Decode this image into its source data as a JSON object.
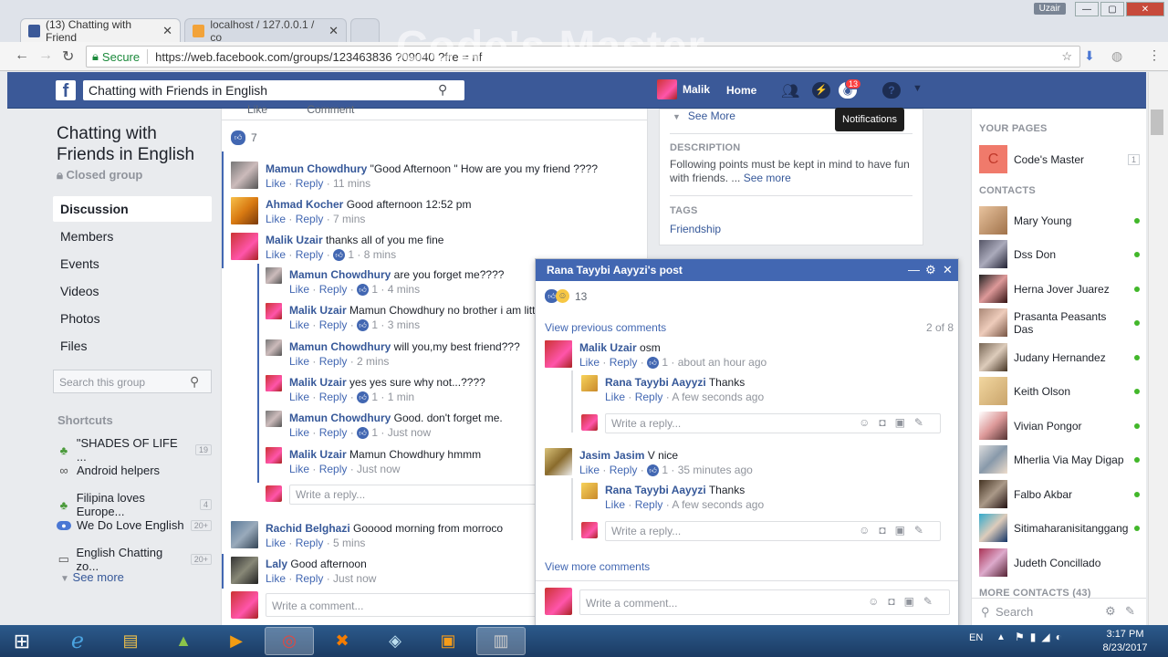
{
  "browser": {
    "tabs": [
      {
        "title": "(13) Chatting with Friend"
      },
      {
        "title": "localhost / 127.0.0.1 / co"
      }
    ],
    "user_badge": "Uzair",
    "secure_label": "Secure",
    "url": "https://web.facebook.com/groups/123463836 ?09040 ?fre = nf",
    "watermark": "Code's Master"
  },
  "fb_header": {
    "search_value": "Chatting with Friends in English",
    "user_name": "Malik",
    "home_label": "Home",
    "notif_count": "13",
    "tooltip": "Notifications"
  },
  "left": {
    "group_name": "Chatting with Friends in English",
    "group_type": "Closed group",
    "nav": [
      {
        "label": "Discussion"
      },
      {
        "label": "Members"
      },
      {
        "label": "Events"
      },
      {
        "label": "Videos"
      },
      {
        "label": "Photos"
      },
      {
        "label": "Files"
      }
    ],
    "search_placeholder": "Search this group",
    "shortcuts_heading": "Shortcuts",
    "shortcuts": [
      {
        "label": "\"SHADES OF LIFE ...",
        "count": "19"
      },
      {
        "label": "Android helpers",
        "count": ""
      },
      {
        "label": "Filipina loves Europe...",
        "count": "4"
      },
      {
        "label": "We Do Love English",
        "count": "20+"
      },
      {
        "label": "English Chatting zo...",
        "count": "20+"
      }
    ],
    "see_more": "See more"
  },
  "feed": {
    "like_label": "Like",
    "comment_label": "Comment",
    "reactions": "7",
    "comments": [
      {
        "name": "Mamun Chowdhury",
        "text": "\"Good Afternoon \" How are you my friend ????",
        "likes": "",
        "time": "11 mins"
      },
      {
        "name": "Ahmad Kocher",
        "text": "Good afternoon 12:52 pm",
        "likes": "",
        "time": "7 mins"
      },
      {
        "name": "Malik Uzair",
        "text": "thanks all of you me fine",
        "likes": "1",
        "time": "8 mins"
      }
    ],
    "replies": [
      {
        "name": "Mamun Chowdhury",
        "text": "are you forget me????",
        "likes": "1",
        "time": "4 mins"
      },
      {
        "name": "Malik Uzair",
        "text": "Mamun Chowdhury no brother i am little b",
        "likes": "1",
        "time": "3 mins"
      },
      {
        "name": "Mamun Chowdhury",
        "text": "will you,my best friend???",
        "likes": "",
        "time": "2 mins"
      },
      {
        "name": "Malik Uzair",
        "text": "yes yes sure why not...????",
        "likes": "1",
        "time": "1 min"
      },
      {
        "name": "Mamun Chowdhury",
        "text": "Good. don't forget me.",
        "likes": "1",
        "time": "Just now"
      },
      {
        "name": "Malik Uzair",
        "text": "Mamun Chowdhury hmmm",
        "likes": "",
        "time": "Just now"
      }
    ],
    "reply_placeholder": "Write a reply...",
    "comments2": [
      {
        "name": "Rachid Belghazi",
        "text": "Gooood morning from morroco",
        "likes": "",
        "time": "5 mins"
      },
      {
        "name": "Laly",
        "text": "Good afternoon",
        "likes": "",
        "time": "Just now"
      }
    ],
    "comment_placeholder": "Write a comment...",
    "action_like": "Like",
    "action_reply": "Reply"
  },
  "about": {
    "see_more": "See More",
    "description_heading": "DESCRIPTION",
    "description": "Following points must be kept in mind to have fun with friends. ...",
    "description_more": "See more",
    "tags_heading": "TAGS",
    "tag": "Friendship"
  },
  "chat": {
    "title": "Rana Tayybi Aayyzi's post",
    "reactions": "13",
    "view_previous": "View previous comments",
    "count": "2 of 8",
    "comments": [
      {
        "name": "Malik Uzair",
        "text": "osm",
        "likes": "1",
        "time": "about an hour ago",
        "reply": {
          "name": "Rana Tayybi Aayyzi",
          "text": "Thanks",
          "time": "A few seconds ago"
        }
      },
      {
        "name": "Jasim Jasim",
        "text": "V nice",
        "likes": "1",
        "time": "35 minutes ago",
        "reply": {
          "name": "Rana Tayybi Aayyzi",
          "text": "Thanks",
          "time": "A few seconds ago"
        }
      }
    ],
    "reply_placeholder": "Write a reply...",
    "view_more": "View more comments",
    "comment_placeholder": "Write a comment..."
  },
  "right": {
    "pages_heading": "YOUR PAGES",
    "page_name": "Code's Master",
    "page_initial": "C",
    "page_count": "1",
    "contacts_heading": "CONTACTS",
    "contacts": [
      {
        "name": "Mary Young"
      },
      {
        "name": "Dss Don"
      },
      {
        "name": "Herna Jover Juarez"
      },
      {
        "name": "Prasanta Peasants Das"
      },
      {
        "name": "Judany Hernandez"
      },
      {
        "name": "Keith Olson"
      },
      {
        "name": "Vivian Pongor"
      },
      {
        "name": "Mherlia Via May Digap"
      },
      {
        "name": "Falbo Akbar"
      },
      {
        "name": "Sitimaharanisitanggang"
      },
      {
        "name": "Judeth Concillado"
      }
    ],
    "more_contacts": "MORE CONTACTS (43)",
    "search_placeholder": "Search"
  },
  "taskbar": {
    "lang": "EN",
    "time": "3:17 PM",
    "date": "8/23/2017"
  },
  "colors": {
    "fb_blue": "#3b5998",
    "link": "#365899",
    "online": "#42b72a"
  }
}
